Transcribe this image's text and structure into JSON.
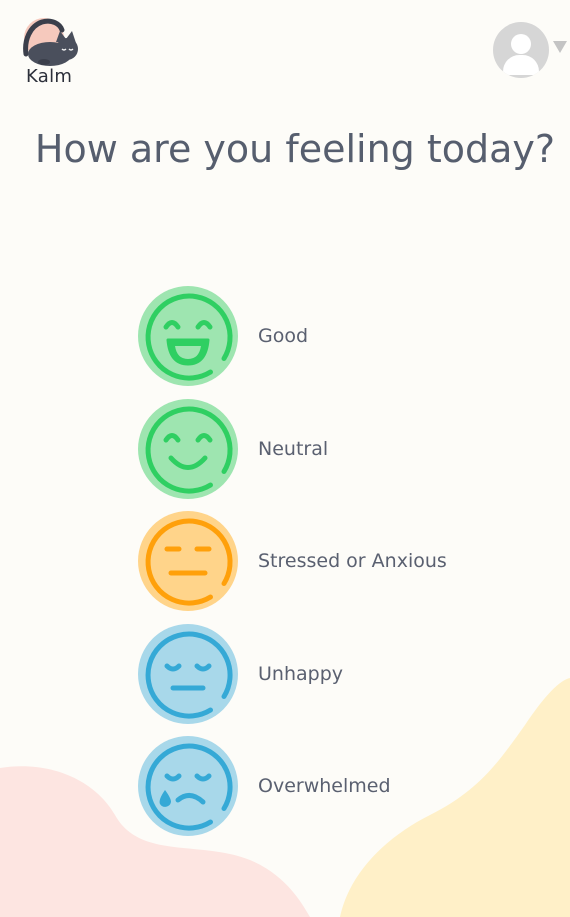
{
  "brand": {
    "name": "Kalm"
  },
  "header": {
    "profile_menu": "user-avatar"
  },
  "prompt": {
    "title": "How are you feeling today?"
  },
  "moods": [
    {
      "label": "Good",
      "icon": "grinning-face-icon",
      "face_bg": "#9ee5b0",
      "face_stroke": "#2fcf62"
    },
    {
      "label": "Neutral",
      "icon": "smiling-face-icon",
      "face_bg": "#9ee5b0",
      "face_stroke": "#2fcf62"
    },
    {
      "label": "Stressed or Anxious",
      "icon": "expressionless-face-icon",
      "face_bg": "#ffd48a",
      "face_stroke": "#ffa00a"
    },
    {
      "label": "Unhappy",
      "icon": "sad-face-icon",
      "face_bg": "#a8d8ea",
      "face_stroke": "#35a9d6"
    },
    {
      "label": "Overwhelmed",
      "icon": "crying-face-icon",
      "face_bg": "#a8d8ea",
      "face_stroke": "#35a9d6"
    }
  ],
  "colors": {
    "background": "#fdfcf8",
    "title": "#565e6e",
    "blob_left": "#fde5e1",
    "blob_right": "#fff0c8"
  }
}
